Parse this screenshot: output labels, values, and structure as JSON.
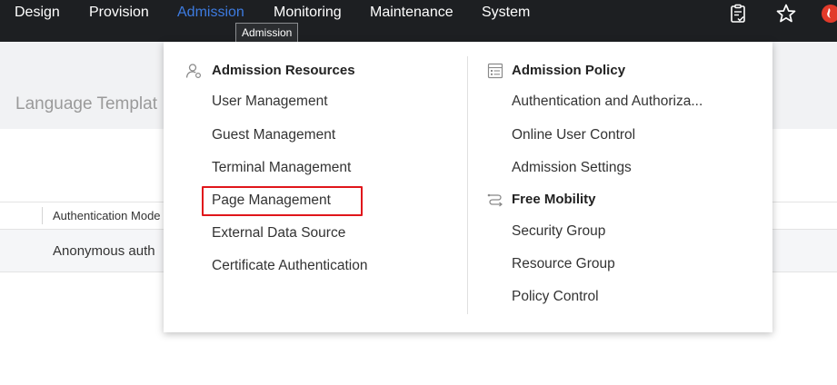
{
  "nav": {
    "items": [
      {
        "label": "Design"
      },
      {
        "label": "Provision"
      },
      {
        "label": "Admission"
      },
      {
        "label": "Monitoring"
      },
      {
        "label": "Maintenance"
      },
      {
        "label": "System"
      }
    ],
    "active_index": 2,
    "active_color": "#3d7be0",
    "tooltip": "Admission",
    "icons": [
      "clipboard-check-icon",
      "star-icon",
      "logo-icon"
    ]
  },
  "background_page": {
    "title": "Language Templat",
    "table": {
      "columns": [
        "Authentication Mode"
      ],
      "rows": [
        [
          "Anonymous auth"
        ]
      ]
    }
  },
  "menu": {
    "admission_resources": {
      "heading": "Admission Resources",
      "icon": "user-gear-icon",
      "items": [
        "User Management",
        "Guest Management",
        "Terminal Management",
        "Page Management",
        "External Data Source",
        "Certificate Authentication"
      ],
      "highlighted_item": "Page Management"
    },
    "admission_policy": {
      "heading": "Admission Policy",
      "icon": "policy-list-icon",
      "items": [
        "Authentication and Authoriza...",
        "Online User Control",
        "Admission Settings"
      ]
    },
    "free_mobility": {
      "heading": "Free Mobility",
      "icon": "mobility-flow-icon",
      "items": [
        "Security Group",
        "Resource Group",
        "Policy Control"
      ]
    }
  },
  "colors": {
    "topbar": "#1d1f22",
    "highlight_border": "#e0161b",
    "logo": "#e23a2a"
  }
}
